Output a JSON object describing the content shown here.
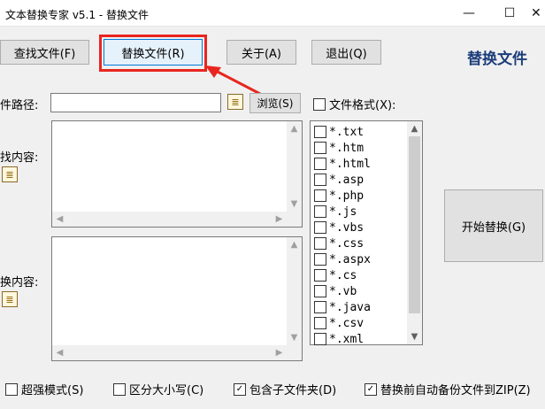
{
  "window": {
    "title": "文本替换专家 v5.1  -  替换文件",
    "minimize": "—",
    "maximize": "☐",
    "close": "✕"
  },
  "toolbar": {
    "find_files": "查找文件(F)",
    "replace_files": "替换文件(R)",
    "about": "关于(A)",
    "exit": "退出(Q)",
    "brand": "替换文件"
  },
  "path": {
    "label": "件路径:",
    "value": "",
    "browse": "浏览(S)",
    "file_format_label": "文件格式(X):"
  },
  "find": {
    "label": "找内容:",
    "value": ""
  },
  "replace": {
    "label": "换内容:",
    "value": ""
  },
  "start_button": "开始替换(G)",
  "file_types": [
    "*.txt",
    "*.htm",
    "*.html",
    "*.asp",
    "*.php",
    "*.js",
    "*.vbs",
    "*.css",
    "*.aspx",
    "*.cs",
    "*.vb",
    "*.java",
    "*.csv",
    "*.xml"
  ],
  "options": {
    "super_mode": "超强模式(S)",
    "case_sensitive": "区分大小写(C)",
    "include_subfolders": "包含子文件夹(D)",
    "backup_zip": "替换前自动备份文件到ZIP(Z)",
    "super_mode_checked": false,
    "case_sensitive_checked": false,
    "include_subfolders_checked": true,
    "backup_zip_checked": true
  },
  "icons": {
    "list_icon": "≣",
    "check_mark": "✓",
    "scroll_up": "▲",
    "scroll_down": "▼",
    "scroll_left": "◀",
    "scroll_right": "▶"
  },
  "colors": {
    "highlight": "#e8261f",
    "brand": "#1b3d7a"
  }
}
